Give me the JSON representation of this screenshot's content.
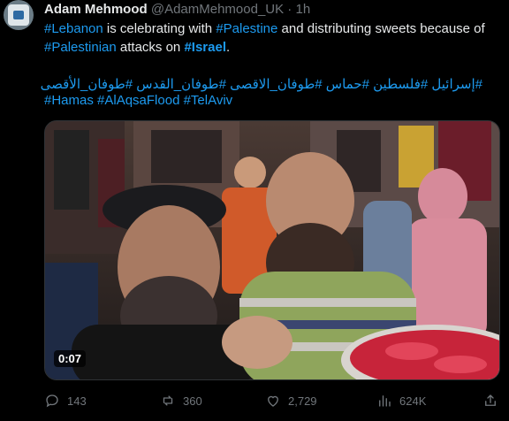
{
  "tweet": {
    "author_name": "Adam Mehmood",
    "author_handle": "@AdamMehmood_UK",
    "separator": " · ",
    "time": "1h",
    "text": {
      "tag_lebanon": "#Lebanon",
      "t1": " is celebrating with ",
      "tag_palestine": "#Palestine",
      "t2": " and distributing sweets because of ",
      "tag_palestinian": "#Palestinian",
      "t3": " attacks on ",
      "tag_israel": "#Israel",
      "t4": "."
    },
    "hashtags_arabic": "#إسرائيل #فلسطين #حماس #طوفان_الاقصى #طوفان_القدس #طوفان_الأقصى",
    "hashtags_latin": "#Hamas #AlAqsaFlood #TelAviv"
  },
  "media": {
    "duration": "0:07"
  },
  "actions": {
    "replies": "143",
    "reposts": "360",
    "likes": "2,729",
    "views": "624K"
  },
  "colors": {
    "background": "#000000",
    "text": "#e7e9ea",
    "muted": "#71767b",
    "link": "#1d9bf0"
  }
}
